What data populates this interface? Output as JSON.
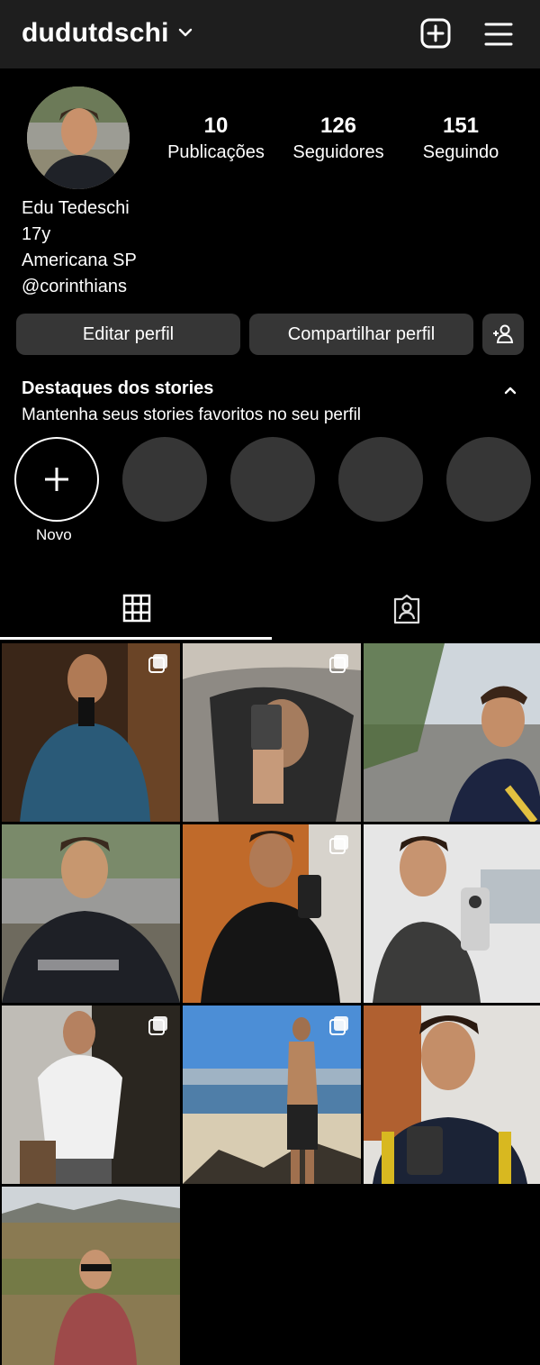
{
  "header": {
    "username": "dudutdschi",
    "icons": {
      "dropdown": "chevron-down-icon",
      "create": "plus-square-icon",
      "menu": "hamburger-menu-icon"
    }
  },
  "profile": {
    "stats": [
      {
        "value": "10",
        "label": "Publicações"
      },
      {
        "value": "126",
        "label": "Seguidores"
      },
      {
        "value": "151",
        "label": "Seguindo"
      }
    ],
    "bio": [
      "Edu Tedeschi",
      "17y",
      "Americana SP",
      "@corinthians"
    ]
  },
  "actions": {
    "edit": "Editar perfil",
    "share": "Compartilhar perfil",
    "discover_icon": "add-person-icon"
  },
  "highlights": {
    "title": "Destaques dos stories",
    "subtitle": "Mantenha seus stories favoritos no seu perfil",
    "new_label": "Novo"
  },
  "tabs": [
    {
      "name": "grid",
      "icon": "grid-icon",
      "active": true
    },
    {
      "name": "tagged",
      "icon": "tagged-person-icon",
      "active": false
    }
  ],
  "posts": [
    {
      "multi": true
    },
    {
      "multi": true
    },
    {
      "multi": false
    },
    {
      "multi": false
    },
    {
      "multi": true
    },
    {
      "multi": false
    },
    {
      "multi": true
    },
    {
      "multi": true
    },
    {
      "multi": false
    },
    {
      "multi": false
    }
  ],
  "colors": {
    "background": "#000000",
    "header": "#1e1e1e",
    "button": "#363636"
  }
}
